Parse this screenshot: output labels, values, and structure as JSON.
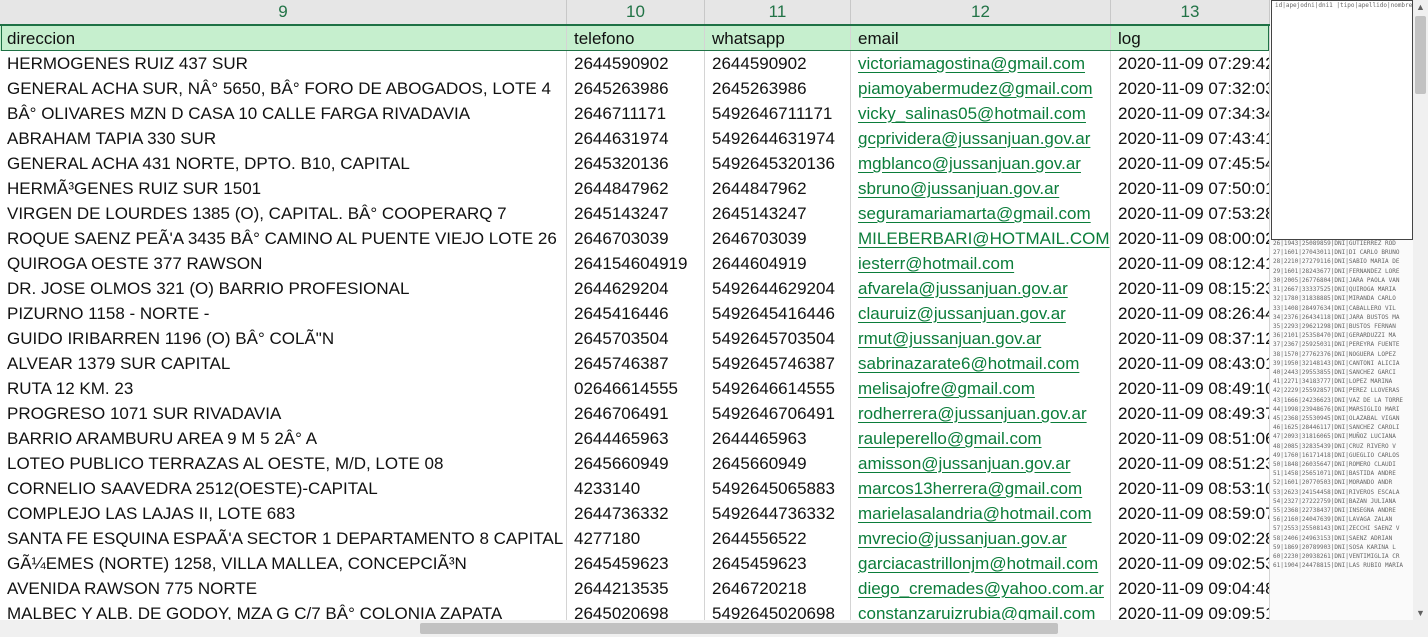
{
  "columns": [
    "9",
    "10",
    "11",
    "12",
    "13"
  ],
  "header": {
    "direccion": "direccion",
    "telefono": "telefono",
    "whatsapp": "whatsapp",
    "email": "email",
    "log": "log"
  },
  "rows": [
    [
      "HERMOGENES RUIZ 437 SUR",
      "2644590902",
      "2644590902",
      "victoriamagostina@gmail.com",
      "2020-11-09 07:29:42"
    ],
    [
      "GENERAL ACHA SUR, NÂ° 5650, BÂ° FORO DE ABOGADOS, LOTE 4",
      "2645263986",
      "2645263986",
      "piamoyabermudez@gmail.com",
      "2020-11-09 07:32:03"
    ],
    [
      "BÂ° OLIVARES MZN D CASA 10 CALLE FARGA RIVADAVIA",
      "2646711171",
      "5492646711171",
      "vicky_salinas05@hotmail.com",
      "2020-11-09 07:34:34"
    ],
    [
      "ABRAHAM TAPIA 330 SUR",
      "2644631974",
      "5492644631974",
      "gcprividera@jussanjuan.gov.ar",
      "2020-11-09 07:43:41"
    ],
    [
      "GENERAL ACHA 431 NORTE, DPTO. B10, CAPITAL",
      "2645320136",
      "5492645320136",
      "mgblanco@jussanjuan.gov.ar",
      "2020-11-09 07:45:54"
    ],
    [
      "HERMÃ³GENES RUIZ SUR 1501",
      "2644847962",
      "2644847962",
      "sbruno@jussanjuan.gov.ar",
      "2020-11-09 07:50:01"
    ],
    [
      "VIRGEN DE LOURDES 1385 (O), CAPITAL. BÂ° COOPERARQ 7",
      "2645143247",
      "2645143247",
      "seguramariamarta@gmail.com",
      "2020-11-09 07:53:28"
    ],
    [
      "ROQUE SAENZ PEÃ'A 3435 BÂ° CAMINO AL PUENTE VIEJO LOTE 26",
      "2646703039",
      "2646703039",
      "MILEBERBARI@HOTMAIL.COM",
      "2020-11-09 08:00:02"
    ],
    [
      "QUIROGA OESTE 377 RAWSON",
      "264154604919",
      "2644604919",
      "iesterr@hotmail.com",
      "2020-11-09 08:12:41"
    ],
    [
      "DR. JOSE OLMOS 321 (O) BARRIO PROFESIONAL",
      "2644629204",
      "5492644629204",
      "afvarela@jussanjuan.gov.ar",
      "2020-11-09 08:15:23"
    ],
    [
      "PIZURNO 1158 - NORTE -",
      "2645416446",
      "5492645416446",
      "clauruiz@jussanjuan.gov.ar",
      "2020-11-09 08:26:44"
    ],
    [
      "GUIDO IRIBARREN 1196 (O) BÂ° COLÃ\"N",
      "2645703504",
      "5492645703504",
      "rmut@jussanjuan.gov.ar",
      "2020-11-09 08:37:12"
    ],
    [
      "ALVEAR 1379 SUR CAPITAL",
      "2645746387",
      "5492645746387",
      "sabrinazarate6@hotmail.com",
      "2020-11-09 08:43:01"
    ],
    [
      "RUTA 12 KM. 23",
      "02646614555",
      "5492646614555",
      "melisajofre@gmail.com",
      "2020-11-09 08:49:10"
    ],
    [
      "PROGRESO 1071 SUR RIVADAVIA",
      "2646706491",
      "5492646706491",
      "rodherrera@jussanjuan.gov.ar",
      "2020-11-09 08:49:37"
    ],
    [
      "BARRIO ARAMBURU AREA 9 M 5 2Â° A",
      "2644465963",
      "2644465963",
      "rauleperello@gmail.com",
      "2020-11-09 08:51:06"
    ],
    [
      "LOTEO PUBLICO TERRAZAS AL OESTE, M/D, LOTE 08",
      "2645660949",
      "2645660949",
      "amisson@jussanjuan.gov.ar",
      "2020-11-09 08:51:23"
    ],
    [
      "CORNELIO SAAVEDRA 2512(OESTE)-CAPITAL",
      "4233140",
      "5492645065883",
      "marcos13herrera@gmail.com",
      "2020-11-09 08:53:10"
    ],
    [
      "COMPLEJO LAS LAJAS II, LOTE 683",
      "2644736332",
      "5492644736332",
      "marielasalandria@hotmail.com",
      "2020-11-09 08:59:07"
    ],
    [
      "SANTA FE ESQUINA ESPAÃ'A SECTOR 1 DEPARTAMENTO 8 CAPITAL",
      "4277180",
      "2644556522",
      "mvrecio@jussanjuan.gov.ar",
      "2020-11-09 09:02:28"
    ],
    [
      "GÃ¼EMES (NORTE) 1258, VILLA MALLEA, CONCEPCIÃ³N",
      "2645459623",
      "2645459623",
      "garciacastrillonjm@hotmail.com",
      "2020-11-09 09:02:53"
    ],
    [
      "AVENIDA RAWSON 775 NORTE",
      "2644213535",
      "2646720218",
      "diego_cremades@yahoo.com.ar",
      "2020-11-09 09:04:48"
    ],
    [
      "MALBEC Y ALB. DE GODOY, MZA G C/7 BÂ° COLONIA ZAPATA",
      "2645020698",
      "5492645020698",
      "constanzaruizrubia@gmail.com",
      "2020-11-09 09:09:51"
    ]
  ],
  "side_preview": {
    "header_text": "id|apejodni|dni1 |tipo|apellido|nombre|f",
    "lines": [
      "1|2574|37247387|DNI|VICTORIA|MARI",
      "2|2304|31125593|DNI|MOYA BERMUD",
      "3|2110|38409637|DNI|SALINAS CALVO",
      "4|1990|36423622|DNI|PRIVIDERA PINT",
      "5|1952|27818740|DNI|BLANCO FERNAN",
      "6|2188|31125747|DNI|BRUNO SAN TIAG",
      "7|2450|25830203|DNI|SEGURA MARIA M",
      "8|2470|36911081|DNI|BERBARI LILIAN",
      "9|2200|25235210|DNI|RODRIGUEZ JUAN",
      "10|2411|27689510|DNI|VARELA CASTRO",
      "11|1991|26698008|DNI|RUIZ CLAUDIA V",
      "12|2234|29494393|DNI|MUT PATON RUT",
      "13|2321|31534051|DNI|ZARATE SABRINA",
      "14|1984|28538958|DNI|JOFRE ROMAN",
      "15|2453|26835871|DNI|HERRERA RODR",
      "16|1129|38531791|DNI|PERELLO SAENZ",
      "17|2233|28085863|DNI|MISSON ANA KAR",
      "18|1909|16331414|DNI|HERRERA MARCO",
      "19|2130|30268461|DNI|SALANDRIA MARI",
      "20|1584|20739868|DNI|RECIO CORREA",
      "21|2180|29740993|DNI|GARCIA CASTRI",
      "22|1609|24090085|DNI|CREMADES BRU",
      "23|2320|30292301|DNI|RUIZ RUBIA CON",
      "24|1757|26089454|DNI|RIVEROS MARIA",
      "25|2324|25507081|DNI|ALAZAR GONZAL",
      "26|1943|25089859|DNI|GUTIERREZ ROD",
      "27|1601|27043011|DNI|DI CARLO BRUNO",
      "28|2210|27279116|DNI|SABIO MARIA DE",
      "29|1601|28243677|DNI|FERNANDEZ LORE",
      "30|2005|26776804|DNI|JARA PAOLA VAN",
      "31|2667|33337525|DNI|QUIROGA MARIA",
      "32|1780|31838885|DNI|MIRANDA CARLO",
      "33|1408|28497634|DNI|CABALLERO VIL",
      "34|2376|26434118|DNI|JARA BUSTOS MA",
      "35|2293|29621298|DNI|BUSTOS FERNAN",
      "36|2101|25358470|DNI|GERARDUZZI MA",
      "37|2367|25925031|DNI|PEREYRA FUENTE",
      "38|1570|27762376|DNI|NOGUERA LOPEZ",
      "39|1950|32148143|DNI|CANTONI ALICIA",
      "40|2443|29553855|DNI|SANCHEZ GARCI",
      "41|2271|34183777|DNI|LOPEZ MARINA",
      "42|2229|25592857|DNI|PEREZ LLOVERAS",
      "43|1666|24236623|DNI|VAZ DE LA TORRE",
      "44|1998|23948676|DNI|MARSIGLIO MARI",
      "45|2368|25530945|DNI|OLAZABAL VIGAN",
      "46|1625|28446117|DNI|SANCHEZ CAROLI",
      "47|2093|31816065|DNI|MUÑOZ LUCIANA",
      "48|2085|32835439|DNI|CRUZ RIVERO V",
      "49|1760|16171418|DNI|GUEGLIO CARLOS",
      "50|1848|26035647|DNI|ROMERO CLAUDI",
      "51|1458|25651071|DNI|BASTIDA ANDRE",
      "52|1601|20770503|DNI|MORANDO ANDR",
      "53|2623|24154458|DNI|RIVEROS ESCALA",
      "54|2327|27222759|DNI|BAZAN JULIANA",
      "55|2368|22738437|DNI|INSEGNA ANDRE",
      "56|2160|24047639|DNI|LAVAGA ZALAN",
      "57|2553|25508143|DNI|ZECCHI SAENZ V",
      "58|2406|24963153|DNI|SAENZ ADRIAN",
      "59|1869|20789903|DNI|SOSA KARINA L",
      "60|2230|20938261|DNI|VENTIMIGLIA CR",
      "61|1904|24478815|DNI|LAS RUBIO MARIA"
    ]
  }
}
